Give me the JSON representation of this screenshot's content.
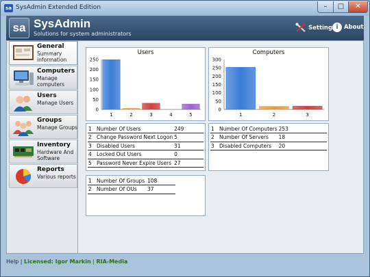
{
  "window": {
    "title": "SysAdmin Extended Edition",
    "app_icon_text": "sa",
    "min": "–",
    "max": "□",
    "close": "✕"
  },
  "header": {
    "logo": "sa",
    "app_name": "SysAdmin",
    "subtitle": "Solutions for system administrators",
    "settings": "Settings",
    "about": "About",
    "about_glyph": "i"
  },
  "sidebar": {
    "items": [
      {
        "title": "General",
        "sub": "Summary information",
        "icon": "board-icon",
        "active": true
      },
      {
        "title": "Computers",
        "sub": "Manage computers",
        "icon": "computer-icon"
      },
      {
        "title": "Users",
        "sub": "Manage Users",
        "icon": "users-icon"
      },
      {
        "title": "Groups",
        "sub": "Manage Groups",
        "icon": "groups-icon"
      },
      {
        "title": "Inventory",
        "sub": "Hardware And Software",
        "icon": "inventory-icon"
      },
      {
        "title": "Reports",
        "sub": "Various reports",
        "icon": "pie-chart-icon"
      }
    ]
  },
  "users_table": [
    {
      "n": "1",
      "label": "Number Of Users",
      "value": "249"
    },
    {
      "n": "2",
      "label": "Change Password Next Logon",
      "value": "5"
    },
    {
      "n": "3",
      "label": "Disabled Users",
      "value": "31"
    },
    {
      "n": "4",
      "label": "Locked Out Users",
      "value": "0"
    },
    {
      "n": "5",
      "label": "Password Never Expire Users",
      "value": "27"
    }
  ],
  "groups_table": [
    {
      "n": "1",
      "label": "Number Of Groups",
      "value": "108"
    },
    {
      "n": "2",
      "label": "Number Of OUs",
      "value": "37"
    }
  ],
  "computers_table": [
    {
      "n": "1",
      "label": "Number Of Computers",
      "value": "253"
    },
    {
      "n": "2",
      "label": "Number Of Servers",
      "value": "18"
    },
    {
      "n": "3",
      "label": "Disabled Computers",
      "value": "20"
    }
  ],
  "footer": {
    "help": "Help",
    "sep1": "|",
    "license": "Licensed: Igor Markin",
    "sep2": "|",
    "company": "RIA-Media"
  },
  "chart_data": [
    {
      "type": "bar",
      "title": "Users",
      "categories": [
        "1",
        "2",
        "3",
        "4",
        "5"
      ],
      "values": [
        249,
        5,
        31,
        0,
        27
      ],
      "ylim": [
        0,
        250
      ],
      "yticks": [
        0,
        50,
        100,
        150,
        200,
        250
      ],
      "colors": [
        "#3b7dd8",
        "#e89a3c",
        "#d04040",
        "#60b040",
        "#9966cc"
      ]
    },
    {
      "type": "bar",
      "title": "Computers",
      "categories": [
        "1",
        "2",
        "3"
      ],
      "values": [
        253,
        18,
        20
      ],
      "ylim": [
        0,
        300
      ],
      "yticks": [
        0,
        50,
        100,
        150,
        200,
        250,
        300
      ],
      "colors": [
        "#3b7dd8",
        "#e89a3c",
        "#d04040"
      ]
    }
  ]
}
